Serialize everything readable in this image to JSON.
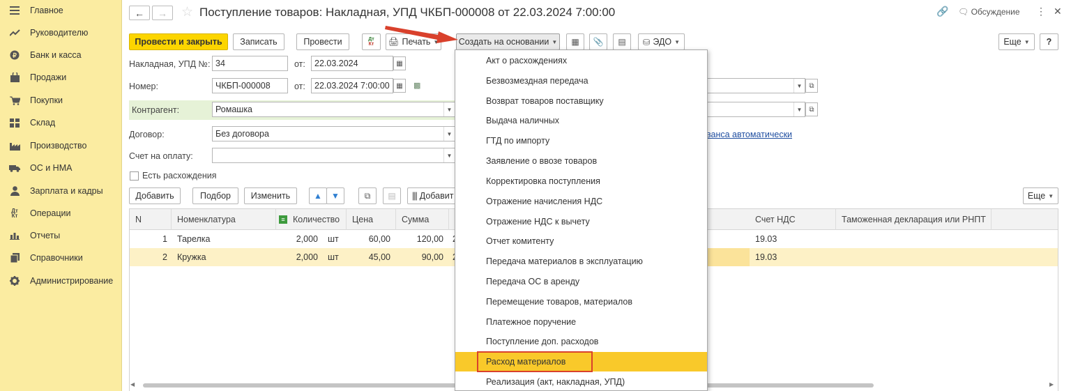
{
  "sidebar": {
    "items": [
      {
        "label": "Главное",
        "icon": "menu-icon"
      },
      {
        "label": "Руководителю",
        "icon": "trend-icon"
      },
      {
        "label": "Банк и касса",
        "icon": "coin-icon"
      },
      {
        "label": "Продажи",
        "icon": "bag-icon"
      },
      {
        "label": "Покупки",
        "icon": "cart-icon"
      },
      {
        "label": "Склад",
        "icon": "grid-icon"
      },
      {
        "label": "Производство",
        "icon": "factory-icon"
      },
      {
        "label": "ОС и НМА",
        "icon": "truck-icon"
      },
      {
        "label": "Зарплата и кадры",
        "icon": "person-icon"
      },
      {
        "label": "Операции",
        "icon": "dt-kt-icon"
      },
      {
        "label": "Отчеты",
        "icon": "bar-chart-icon"
      },
      {
        "label": "Справочники",
        "icon": "book-icon"
      },
      {
        "label": "Администрирование",
        "icon": "gear-icon"
      }
    ]
  },
  "header": {
    "title": "Поступление товаров: Накладная, УПД ЧКБП-000008 от 22.03.2024 7:00:00",
    "discussion": "Обсуждение"
  },
  "toolbar": {
    "post_close": "Провести и закрыть",
    "save": "Записать",
    "post": "Провести",
    "dt_kt": "Дт Кт",
    "print": "Печать",
    "create_based": "Создать на основании",
    "edo": "ЭДО",
    "more": "Еще",
    "help": "?"
  },
  "form": {
    "invoice_label": "Накладная, УПД №:",
    "invoice_value": "34",
    "from_label1": "от:",
    "invoice_date": "22.03.2024",
    "number_label": "Номер:",
    "number_value": "ЧКБП-000008",
    "from_label2": "от:",
    "number_date": "22.03.2024  7:00:00",
    "contractor_label": "Контрагент:",
    "contractor_value": "Ромашка",
    "contract_label": "Договор:",
    "contract_value": "Без договора",
    "invoice_pay_label": "Счет на оплату:",
    "invoice_pay_value": "",
    "advance_link": "ванса автоматически",
    "discrepancy_label": "Есть расхождения"
  },
  "table_toolbar": {
    "add": "Добавить",
    "pick": "Подбор",
    "edit": "Изменить",
    "add_barcode": "Добавит",
    "more": "Еще"
  },
  "table": {
    "headers": [
      "N",
      "Номенклатура",
      "Количество",
      "Цена",
      "Сумма",
      "Счет НДС",
      "Таможенная декларация или РНПТ"
    ],
    "rows": [
      {
        "n": "1",
        "name": "Тарелка",
        "qty": "2,000",
        "unit": "шт",
        "price": "60,00",
        "sum": "120,00",
        "rate": "2",
        "vat_acc": "19.03"
      },
      {
        "n": "2",
        "name": "Кружка",
        "qty": "2,000",
        "unit": "шт",
        "price": "45,00",
        "sum": "90,00",
        "rate": "2",
        "vat_acc": "19.03"
      }
    ]
  },
  "menu": {
    "items": [
      "Акт о расхождениях",
      "Безвозмездная передача",
      "Возврат товаров поставщику",
      "Выдача наличных",
      "ГТД по импорту",
      "Заявление о ввозе товаров",
      "Корректировка поступления",
      "Отражение начисления НДС",
      "Отражение НДС к вычету",
      "Отчет комитенту",
      "Передача материалов в эксплуатацию",
      "Передача ОС в аренду",
      "Перемещение товаров, материалов",
      "Платежное поручение",
      "Поступление доп. расходов",
      "Расход материалов",
      "Реализация (акт, накладная, УПД)"
    ],
    "highlighted_index": 15
  },
  "colors": {
    "sidebar_bg": "#fbeca1",
    "primary_button": "#fcd500",
    "menu_highlight": "#f9c92a",
    "annotation_red": "#d9412c",
    "selected_row": "#fdf1c6"
  }
}
